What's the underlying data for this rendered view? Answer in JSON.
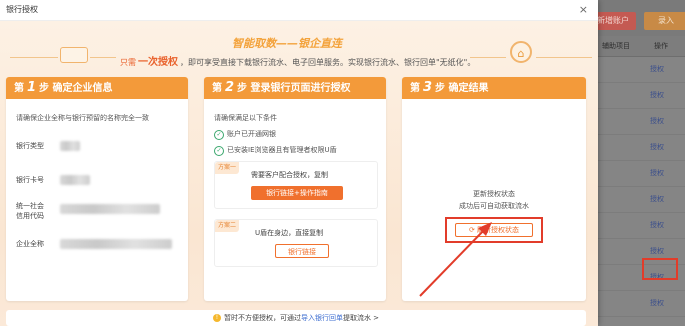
{
  "background_app": {
    "top_buttons": [
      "新增账户",
      "录入"
    ],
    "table_headers": [
      "辅助项目",
      "操作"
    ],
    "row_links": [
      "授权",
      "授权",
      "授权",
      "授权",
      "授权",
      "授权",
      "授权",
      "授权",
      "授权",
      "授权"
    ]
  },
  "dialog": {
    "title": "银行授权",
    "close_icon": "×",
    "banner": {
      "main": "智能取数——银企直连",
      "sub_prefix": "只需",
      "sub_highlight": "一次授权",
      "sub_rest": "，即可享受直接下载银行流水、电子回单服务。实现银行流水、银行回单\"无纸化\"。"
    },
    "steps": [
      {
        "prefix": "第",
        "num": "1",
        "suffix": "步 确定企业信息"
      },
      {
        "prefix": "第",
        "num": "2",
        "suffix": "步 登录银行页面进行授权"
      },
      {
        "prefix": "第",
        "num": "3",
        "suffix": "步 确定结果"
      }
    ],
    "step1": {
      "hint": "请确保企业全称与银行预留的名称完全一致",
      "fields": [
        "银行类型",
        "银行卡号",
        "统一社会",
        "信用代码",
        "企业全称"
      ]
    },
    "step2": {
      "condition": "请确保满足以下条件",
      "checks": [
        "账户已开通网银",
        "已安装IE浏览器且有管理者权限U盾"
      ],
      "plan1": {
        "tag": "方案一",
        "text": "需要客户配合授权，复制",
        "button": "银行链接+操作指南"
      },
      "plan2": {
        "tag": "方案二",
        "text": "U盾在身边，直接复制",
        "button": "银行链接"
      }
    },
    "step3": {
      "status1": "更新授权状态",
      "status2": "成功后可自动获取流水",
      "refresh_button": "刷新授权状态"
    },
    "footer": {
      "text_before": "暂时不方便授权，可通过",
      "link": "导入银行回单",
      "text_after": "提取流水 >"
    }
  }
}
